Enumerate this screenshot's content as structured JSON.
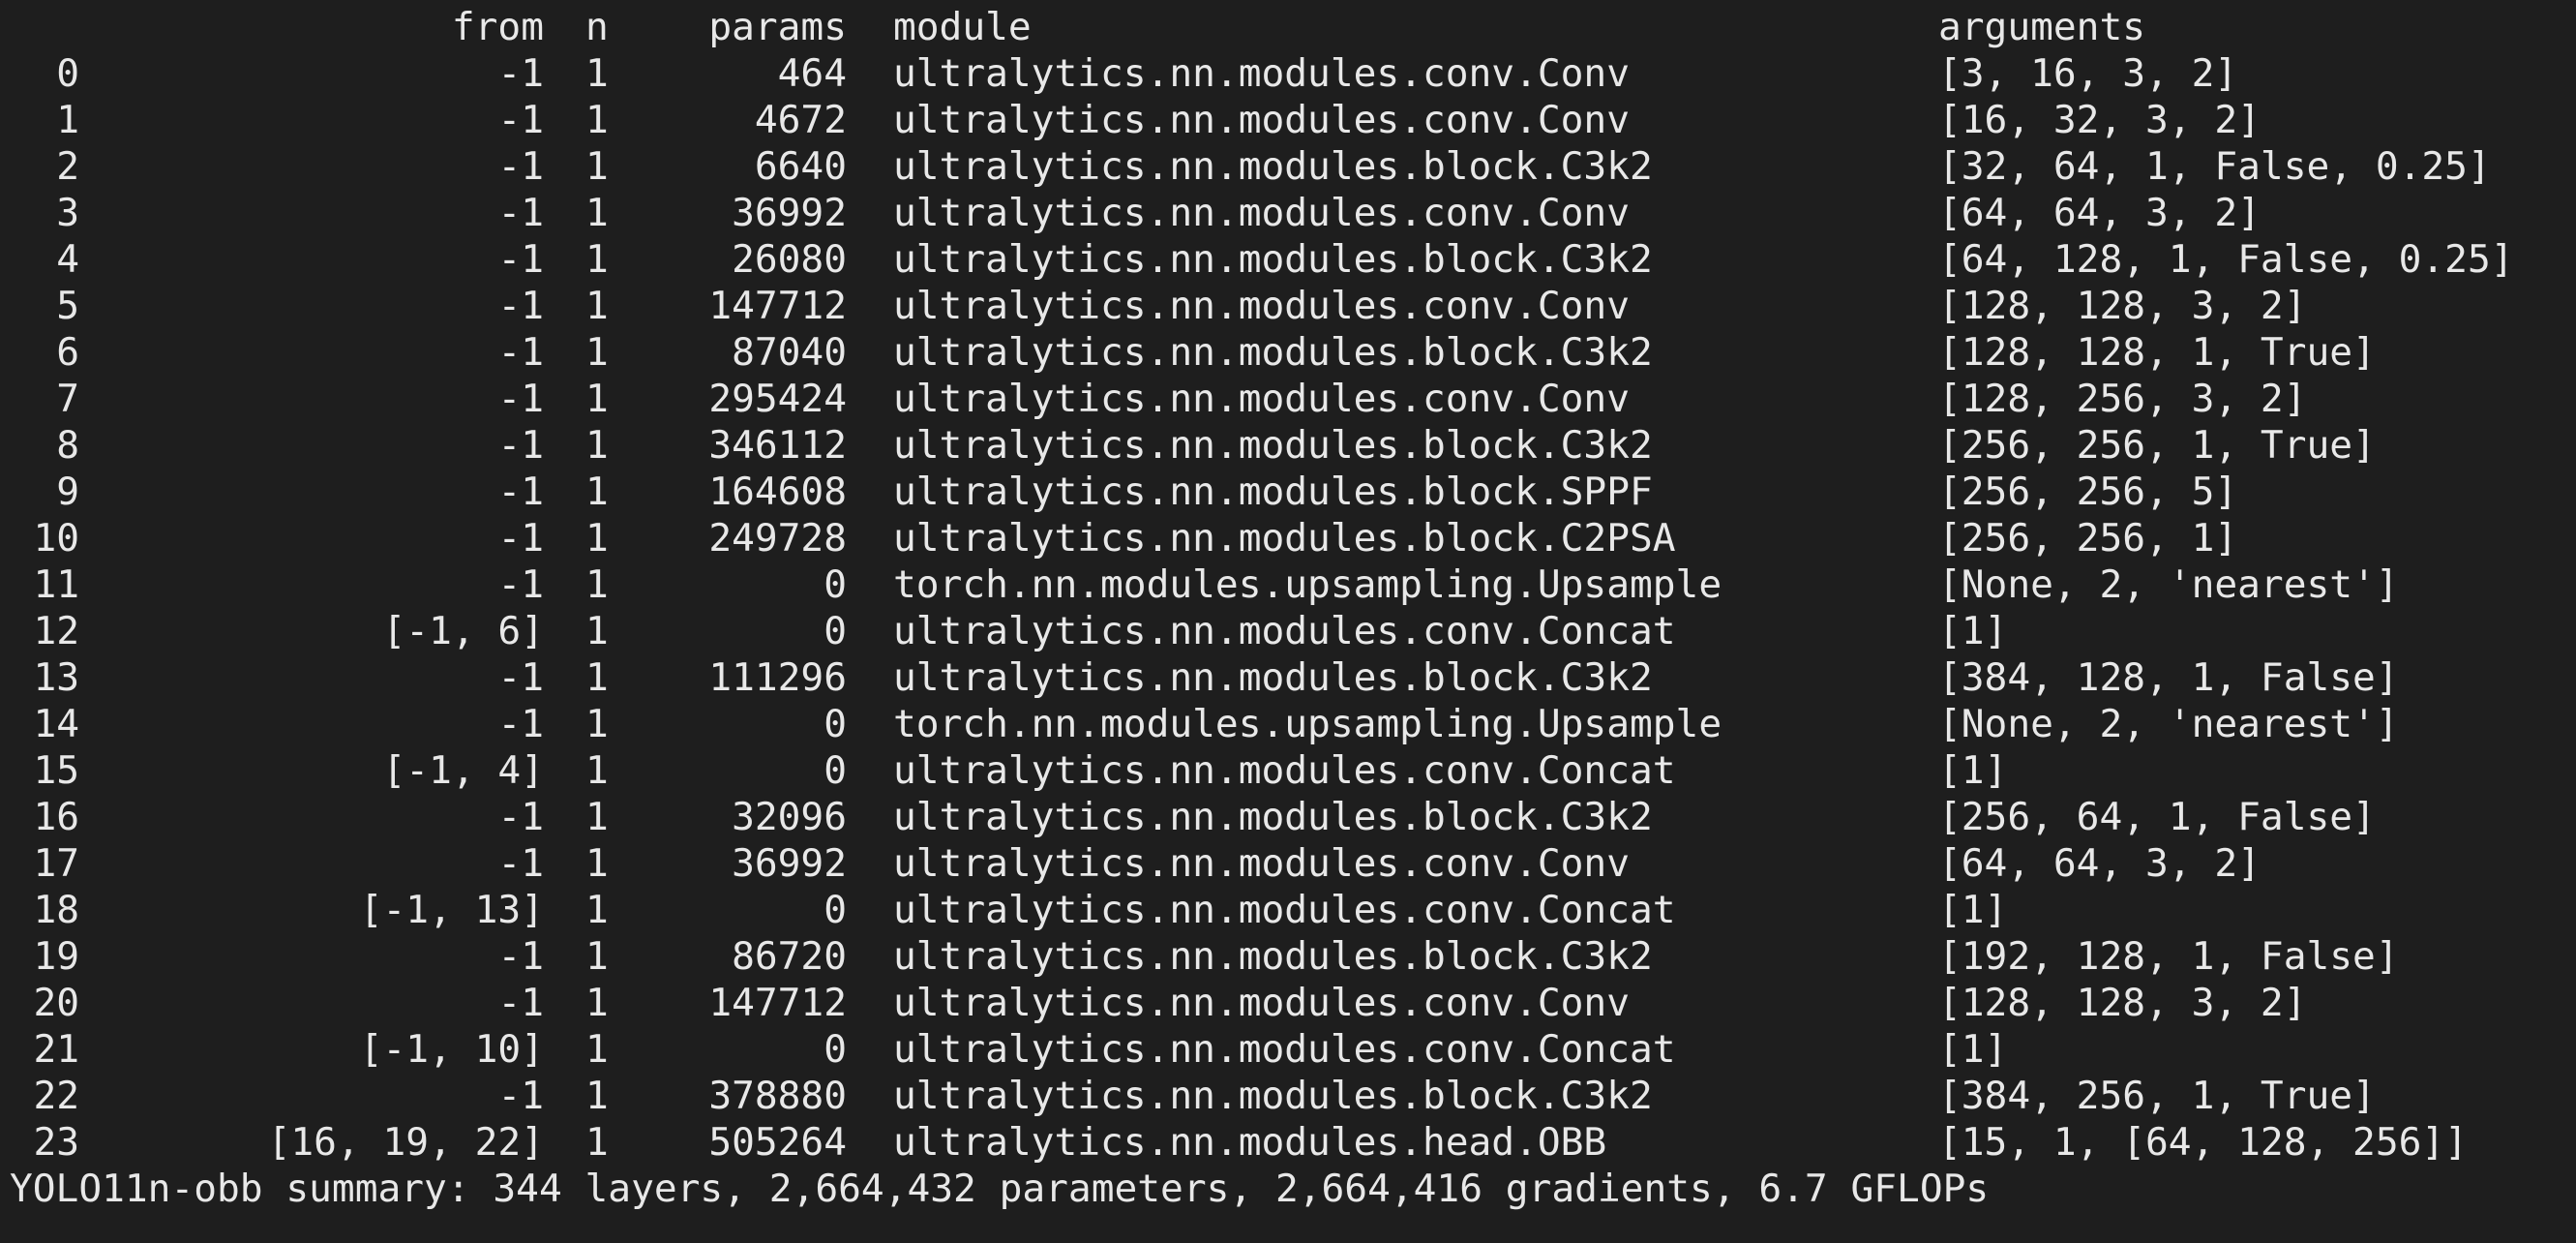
{
  "header": {
    "from": "from",
    "n": "n",
    "params": "params",
    "module": "module",
    "arguments": "arguments"
  },
  "rows": [
    {
      "idx": "0",
      "from": "-1",
      "n": "1",
      "params": "464",
      "module": "ultralytics.nn.modules.conv.Conv",
      "arguments": "[3, 16, 3, 2]"
    },
    {
      "idx": "1",
      "from": "-1",
      "n": "1",
      "params": "4672",
      "module": "ultralytics.nn.modules.conv.Conv",
      "arguments": "[16, 32, 3, 2]"
    },
    {
      "idx": "2",
      "from": "-1",
      "n": "1",
      "params": "6640",
      "module": "ultralytics.nn.modules.block.C3k2",
      "arguments": "[32, 64, 1, False, 0.25]"
    },
    {
      "idx": "3",
      "from": "-1",
      "n": "1",
      "params": "36992",
      "module": "ultralytics.nn.modules.conv.Conv",
      "arguments": "[64, 64, 3, 2]"
    },
    {
      "idx": "4",
      "from": "-1",
      "n": "1",
      "params": "26080",
      "module": "ultralytics.nn.modules.block.C3k2",
      "arguments": "[64, 128, 1, False, 0.25]"
    },
    {
      "idx": "5",
      "from": "-1",
      "n": "1",
      "params": "147712",
      "module": "ultralytics.nn.modules.conv.Conv",
      "arguments": "[128, 128, 3, 2]"
    },
    {
      "idx": "6",
      "from": "-1",
      "n": "1",
      "params": "87040",
      "module": "ultralytics.nn.modules.block.C3k2",
      "arguments": "[128, 128, 1, True]"
    },
    {
      "idx": "7",
      "from": "-1",
      "n": "1",
      "params": "295424",
      "module": "ultralytics.nn.modules.conv.Conv",
      "arguments": "[128, 256, 3, 2]"
    },
    {
      "idx": "8",
      "from": "-1",
      "n": "1",
      "params": "346112",
      "module": "ultralytics.nn.modules.block.C3k2",
      "arguments": "[256, 256, 1, True]"
    },
    {
      "idx": "9",
      "from": "-1",
      "n": "1",
      "params": "164608",
      "module": "ultralytics.nn.modules.block.SPPF",
      "arguments": "[256, 256, 5]"
    },
    {
      "idx": "10",
      "from": "-1",
      "n": "1",
      "params": "249728",
      "module": "ultralytics.nn.modules.block.C2PSA",
      "arguments": "[256, 256, 1]"
    },
    {
      "idx": "11",
      "from": "-1",
      "n": "1",
      "params": "0",
      "module": "torch.nn.modules.upsampling.Upsample",
      "arguments": "[None, 2, 'nearest']"
    },
    {
      "idx": "12",
      "from": "[-1, 6]",
      "n": "1",
      "params": "0",
      "module": "ultralytics.nn.modules.conv.Concat",
      "arguments": "[1]"
    },
    {
      "idx": "13",
      "from": "-1",
      "n": "1",
      "params": "111296",
      "module": "ultralytics.nn.modules.block.C3k2",
      "arguments": "[384, 128, 1, False]"
    },
    {
      "idx": "14",
      "from": "-1",
      "n": "1",
      "params": "0",
      "module": "torch.nn.modules.upsampling.Upsample",
      "arguments": "[None, 2, 'nearest']"
    },
    {
      "idx": "15",
      "from": "[-1, 4]",
      "n": "1",
      "params": "0",
      "module": "ultralytics.nn.modules.conv.Concat",
      "arguments": "[1]"
    },
    {
      "idx": "16",
      "from": "-1",
      "n": "1",
      "params": "32096",
      "module": "ultralytics.nn.modules.block.C3k2",
      "arguments": "[256, 64, 1, False]"
    },
    {
      "idx": "17",
      "from": "-1",
      "n": "1",
      "params": "36992",
      "module": "ultralytics.nn.modules.conv.Conv",
      "arguments": "[64, 64, 3, 2]"
    },
    {
      "idx": "18",
      "from": "[-1, 13]",
      "n": "1",
      "params": "0",
      "module": "ultralytics.nn.modules.conv.Concat",
      "arguments": "[1]"
    },
    {
      "idx": "19",
      "from": "-1",
      "n": "1",
      "params": "86720",
      "module": "ultralytics.nn.modules.block.C3k2",
      "arguments": "[192, 128, 1, False]"
    },
    {
      "idx": "20",
      "from": "-1",
      "n": "1",
      "params": "147712",
      "module": "ultralytics.nn.modules.conv.Conv",
      "arguments": "[128, 128, 3, 2]"
    },
    {
      "idx": "21",
      "from": "[-1, 10]",
      "n": "1",
      "params": "0",
      "module": "ultralytics.nn.modules.conv.Concat",
      "arguments": "[1]"
    },
    {
      "idx": "22",
      "from": "-1",
      "n": "1",
      "params": "378880",
      "module": "ultralytics.nn.modules.block.C3k2",
      "arguments": "[384, 256, 1, True]"
    },
    {
      "idx": "23",
      "from": "[16, 19, 22]",
      "n": "1",
      "params": "505264",
      "module": "ultralytics.nn.modules.head.OBB",
      "arguments": "[15, 1, [64, 128, 256]]"
    }
  ],
  "summary": "YOLO11n-obb summary: 344 layers, 2,664,432 parameters, 2,664,416 gradients, 6.7 GFLOPs",
  "colors": {
    "background": "#1e1e1e",
    "text": "#e8e8e8"
  }
}
